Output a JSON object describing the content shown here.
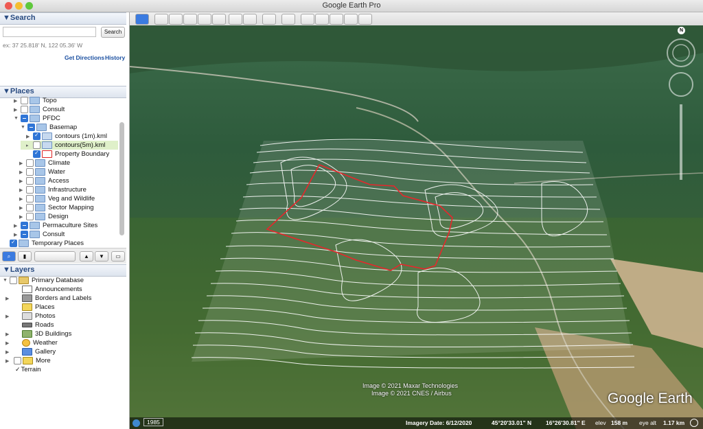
{
  "window": {
    "title": "Google Earth Pro"
  },
  "search": {
    "header": "▼Search",
    "placeholder": "",
    "button": "Search",
    "hint": "ex: 37 25.818' N, 122 05.36' W",
    "get_directions": "Get Directions",
    "history": "History"
  },
  "places": {
    "header": "▼Places",
    "items": [
      {
        "label": "Topo"
      },
      {
        "label": "Consult"
      },
      {
        "label": "PFDC"
      },
      {
        "label": "Basemap"
      },
      {
        "label": "contours (1m).kml"
      },
      {
        "label": "contours(5m).kml"
      },
      {
        "label": "Property Boundary"
      },
      {
        "label": "Climate"
      },
      {
        "label": "Water"
      },
      {
        "label": "Access"
      },
      {
        "label": "Infrastructure"
      },
      {
        "label": "Veg and Wildlife"
      },
      {
        "label": "Sector Mapping"
      },
      {
        "label": "Design"
      },
      {
        "label": "Permaculture Sites"
      },
      {
        "label": "Consult"
      },
      {
        "label": "Temporary Places"
      }
    ]
  },
  "layers": {
    "header": "▼Layers",
    "items": [
      {
        "label": "Primary Database"
      },
      {
        "label": "Announcements"
      },
      {
        "label": "Borders and Labels"
      },
      {
        "label": "Places"
      },
      {
        "label": "Photos"
      },
      {
        "label": "Roads"
      },
      {
        "label": "3D Buildings"
      },
      {
        "label": "Weather"
      },
      {
        "label": "Gallery"
      },
      {
        "label": "More"
      },
      {
        "label": "Terrain"
      }
    ]
  },
  "map": {
    "attribution_1": "Image © 2021 Maxar Technologies",
    "attribution_2": "Image © 2021 CNES / Airbus",
    "logo": "Google Earth",
    "compass_n": "N",
    "status": {
      "year": "1985",
      "imagery_date": "Imagery Date: 6/12/2020",
      "lat": "45°20'33.01\" N",
      "lon": "16°26'30.81\" E",
      "elev_label": "elev",
      "elev": "158 m",
      "eye_label": "eye alt",
      "eye": "1.17 km"
    }
  },
  "colors": {
    "boundary": "#e8262b",
    "contours": "#ffffff",
    "selected_row": "#dff0c9"
  }
}
